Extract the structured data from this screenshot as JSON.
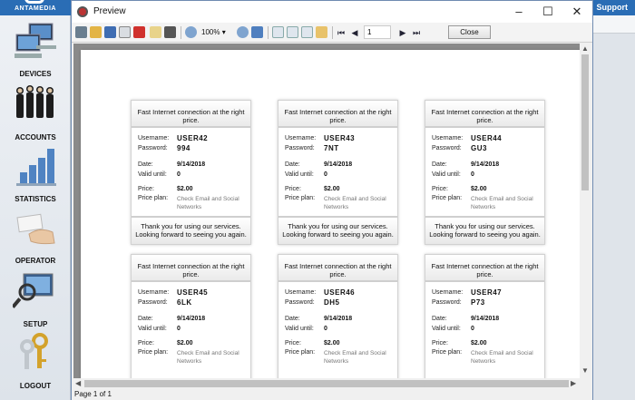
{
  "sidebar": {
    "brand": "ANTAMEDIA",
    "items": [
      {
        "label": "DEVICES"
      },
      {
        "label": "ACCOUNTS"
      },
      {
        "label": "STATISTICS"
      },
      {
        "label": "OPERATOR"
      },
      {
        "label": "SETUP"
      },
      {
        "label": "LOGOUT"
      }
    ]
  },
  "appbar": {
    "support": "Support"
  },
  "window": {
    "title": "Preview",
    "zoom": "100%",
    "page_number": "1",
    "close_label": "Close",
    "status": "Page 1 of 1"
  },
  "tickets": [
    {
      "header": "Fast Internet connection at the right price.",
      "username_label": "Username:",
      "username": "USER42",
      "password_label": "Password:",
      "password": "994",
      "date_label": "Date:",
      "date": "9/14/2018",
      "valid_label": "Valid until:",
      "valid": "0",
      "price_label": "Price:",
      "price": "$2.00",
      "plan_label": "Price plan:",
      "plan": "Check Email and Social Networks",
      "footer": "Thank you for using our services. Looking forward to seeing you again."
    },
    {
      "header": "Fast Internet connection at the right price.",
      "username_label": "Username:",
      "username": "USER43",
      "password_label": "Password:",
      "password": "7NT",
      "date_label": "Date:",
      "date": "9/14/2018",
      "valid_label": "Valid until:",
      "valid": "0",
      "price_label": "Price:",
      "price": "$2.00",
      "plan_label": "Price plan:",
      "plan": "Check Email and Social Networks",
      "footer": "Thank you for using our services. Looking forward to seeing you again."
    },
    {
      "header": "Fast Internet connection at the right price.",
      "username_label": "Username:",
      "username": "USER44",
      "password_label": "Password:",
      "password": "GU3",
      "date_label": "Date:",
      "date": "9/14/2018",
      "valid_label": "Valid until:",
      "valid": "0",
      "price_label": "Price:",
      "price": "$2.00",
      "plan_label": "Price plan:",
      "plan": "Check Email and Social Networks",
      "footer": "Thank you for using our services. Looking forward to seeing you again."
    },
    {
      "header": "Fast Internet connection at the right price.",
      "username_label": "Username:",
      "username": "USER45",
      "password_label": "Password:",
      "password": "6LK",
      "date_label": "Date:",
      "date": "9/14/2018",
      "valid_label": "Valid until:",
      "valid": "0",
      "price_label": "Price:",
      "price": "$2.00",
      "plan_label": "Price plan:",
      "plan": "Check Email and Social Networks",
      "footer": ""
    },
    {
      "header": "Fast Internet connection at the right price.",
      "username_label": "Username:",
      "username": "USER46",
      "password_label": "Password:",
      "password": "DH5",
      "date_label": "Date:",
      "date": "9/14/2018",
      "valid_label": "Valid until:",
      "valid": "0",
      "price_label": "Price:",
      "price": "$2.00",
      "plan_label": "Price plan:",
      "plan": "Check Email and Social Networks",
      "footer": ""
    },
    {
      "header": "Fast Internet connection at the right price.",
      "username_label": "Username:",
      "username": "USER47",
      "password_label": "Password:",
      "password": "P73",
      "date_label": "Date:",
      "date": "9/14/2018",
      "valid_label": "Valid until:",
      "valid": "0",
      "price_label": "Price:",
      "price": "$2.00",
      "plan_label": "Price plan:",
      "plan": "Check Email and Social Networks",
      "footer": ""
    }
  ]
}
